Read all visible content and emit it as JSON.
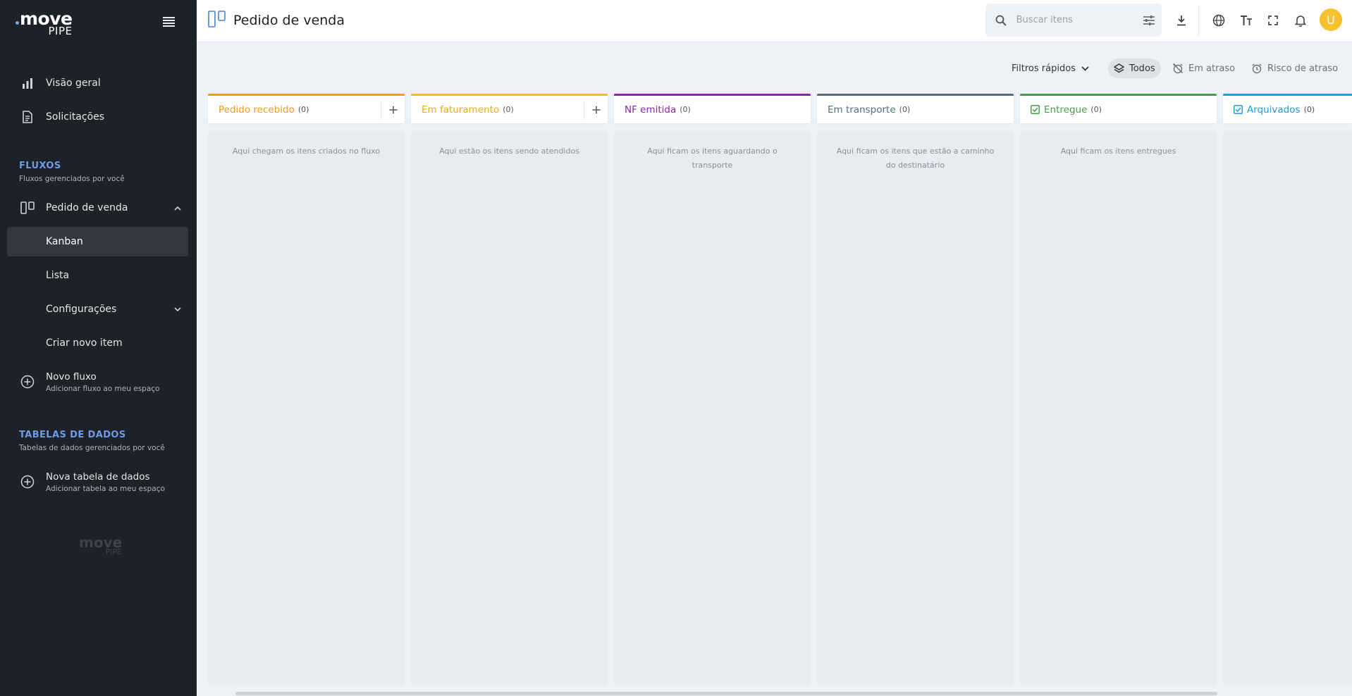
{
  "sidebar": {
    "logo_main": "move",
    "logo_sub": "PIPE",
    "nav": [
      {
        "label": "Visão geral"
      },
      {
        "label": "Solicitações"
      }
    ],
    "fluxos": {
      "title": "FLUXOS",
      "subtitle": "Fluxos gerenciados por você",
      "flow_label": "Pedido de venda",
      "subitems": [
        {
          "label": "Kanban"
        },
        {
          "label": "Lista"
        },
        {
          "label": "Configurações"
        },
        {
          "label": "Criar novo item"
        }
      ],
      "new_flow_title": "Novo fluxo",
      "new_flow_sub": "Adicionar fluxo ao meu espaço"
    },
    "tabelas": {
      "title": "TABELAS DE DADOS",
      "subtitle": "Tabelas de dados gerenciados por você",
      "new_table_title": "Nova tabela de dados",
      "new_table_sub": "Adicionar tabela ao meu espaço"
    },
    "footer_logo_main": "move",
    "footer_logo_sub": "PIPE"
  },
  "header": {
    "title": "Pedido de venda",
    "search_placeholder": "Buscar itens",
    "avatar_letter": "U"
  },
  "filters": {
    "quick": "Filtros rápidos",
    "all": "Todos",
    "late": "Em atraso",
    "risk": "Risco de atraso"
  },
  "colors": {
    "pedido_recebido": "#f39a1f",
    "em_faturamento": "#f5b82e",
    "nf_emitida": "#8e24aa",
    "em_transporte": "#546e7a",
    "entregue": "#43a047",
    "arquivados": "#1e9be0"
  },
  "columns": [
    {
      "name": "Pedido recebido",
      "count": "(0)",
      "empty": "Aqui chegam os itens criados no fluxo"
    },
    {
      "name": "Em faturamento",
      "count": "(0)",
      "empty": "Aqui estão os itens sendo atendidos"
    },
    {
      "name": "NF emitida",
      "count": "(0)",
      "empty": "Aqui ficam os itens aguardando o transporte"
    },
    {
      "name": "Em transporte",
      "count": "(0)",
      "empty": "Aqui ficam os itens que estão a caminho do destinatário"
    },
    {
      "name": "Entregue",
      "count": "(0)",
      "empty": "Aqui ficam os itens entregues"
    },
    {
      "name": "Arquivados",
      "count": "(0)",
      "empty": ""
    }
  ]
}
